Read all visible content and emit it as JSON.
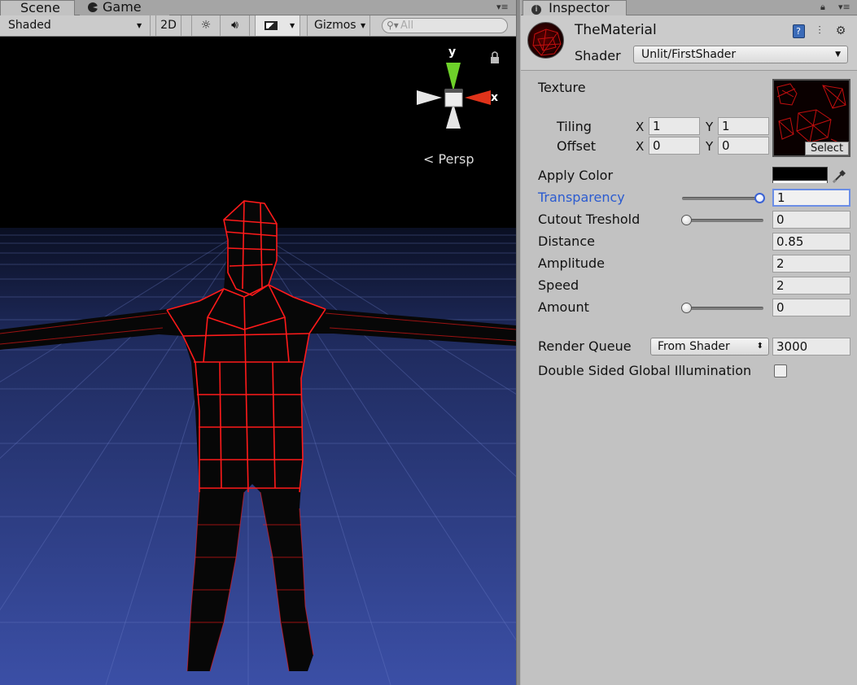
{
  "scene_tabs": {
    "scene_label": "Scene",
    "game_label": "Game"
  },
  "scene_toolbar": {
    "shading_mode": "Shaded",
    "two_d_label": "2D",
    "gizmos_label": "Gizmos",
    "search_placeholder": "All"
  },
  "scene_view": {
    "gizmo_y": "y",
    "gizmo_x": "x",
    "projection": "Persp",
    "wire_color": "#ff1a1a",
    "sky_color": "#000000",
    "ground_color": "#3a4da0"
  },
  "inspector": {
    "tab_label": "Inspector",
    "material_name": "TheMaterial",
    "shader_label": "Shader",
    "shader_value": "Unlit/FirstShader",
    "texture": {
      "label": "Texture",
      "tiling_label": "Tiling",
      "offset_label": "Offset",
      "x_axis": "X",
      "y_axis": "Y",
      "tiling_x": "1",
      "tiling_y": "1",
      "offset_x": "0",
      "offset_y": "0",
      "select_label": "Select"
    },
    "apply_color": {
      "label": "Apply Color",
      "value": "#000000"
    },
    "transparency": {
      "label": "Transparency",
      "value": "1",
      "slider_fraction": 1.0
    },
    "cutout": {
      "label": "Cutout Treshold",
      "value": "0",
      "slider_fraction": 0.0
    },
    "distance": {
      "label": "Distance",
      "value": "0.85"
    },
    "amplitude": {
      "label": "Amplitude",
      "value": "2"
    },
    "speed": {
      "label": "Speed",
      "value": "2"
    },
    "amount": {
      "label": "Amount",
      "value": "0",
      "slider_fraction": 0.0
    },
    "render_queue": {
      "label": "Render Queue",
      "mode": "From Shader",
      "value": "3000"
    },
    "double_sided_gi": {
      "label": "Double Sided Global Illumination",
      "checked": false
    }
  }
}
